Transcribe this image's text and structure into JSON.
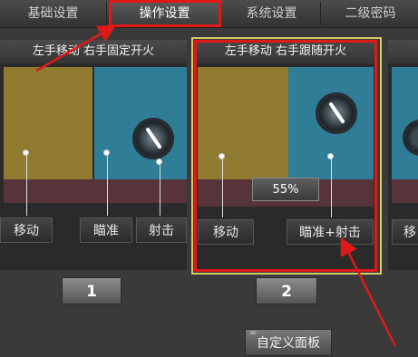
{
  "tabs": [
    {
      "label": "基础设置",
      "active": false
    },
    {
      "label": "操作设置",
      "active": true
    },
    {
      "label": "系统设置",
      "active": false
    },
    {
      "label": "二级密码",
      "active": false
    }
  ],
  "panels": [
    {
      "title": "左手移动 右手固定开火",
      "labels": [
        "移动",
        "瞄准",
        "射击"
      ],
      "number": "1"
    },
    {
      "title": "左手移动 右手跟随开火",
      "labels": [
        "移动",
        "瞄准+射击"
      ],
      "number": "2",
      "zoom": "55%"
    },
    {
      "labels": [
        "移"
      ]
    }
  ],
  "custom_panel_button": "自定义面板",
  "custom_panel_corner": "=",
  "colors": {
    "highlight": "#e01818",
    "zone_yellow": "#8f7a2f",
    "zone_blue": "#2f7d96"
  },
  "icons": [
    "knob-icon",
    "callout-arrow-icon"
  ]
}
